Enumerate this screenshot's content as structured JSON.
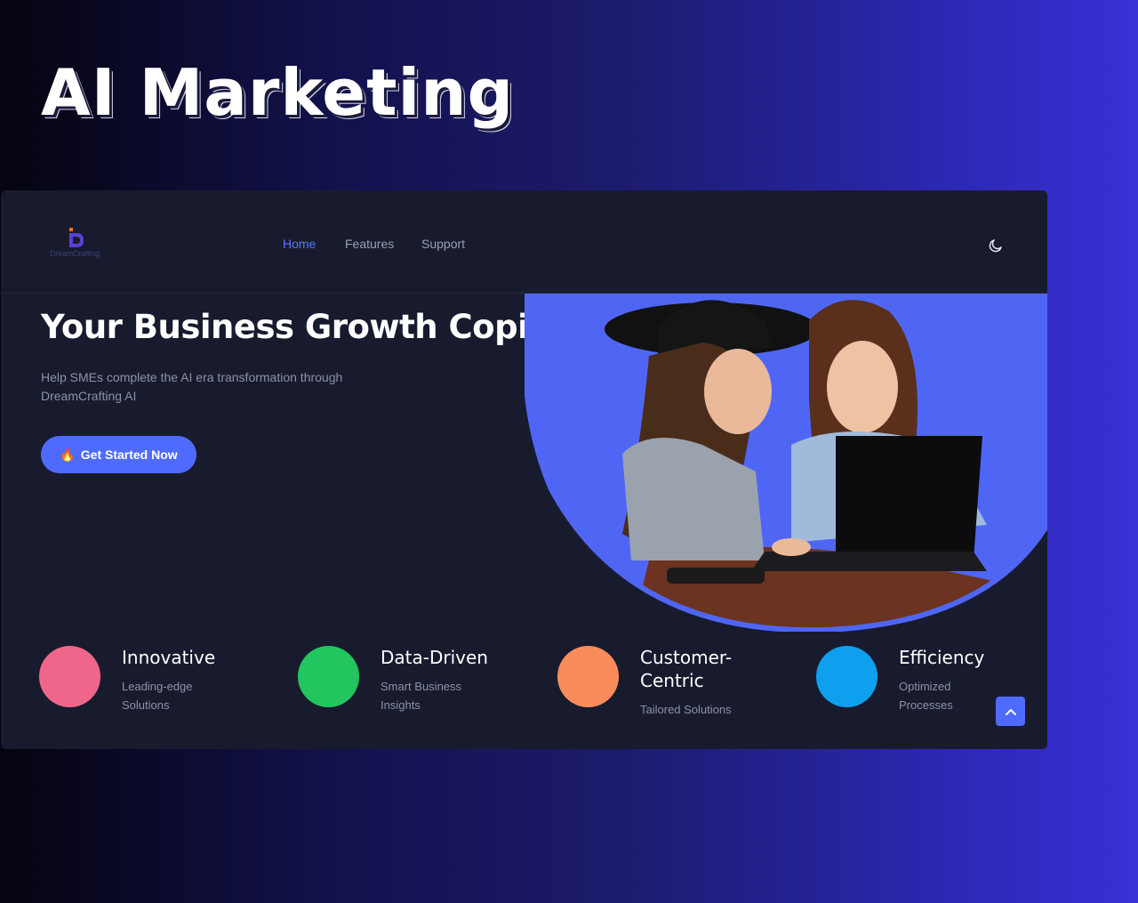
{
  "promo": {
    "title": "AI Marketing"
  },
  "app": {
    "logo_text": "DreamCrafting",
    "nav": [
      {
        "label": "Home",
        "active": true
      },
      {
        "label": "Features",
        "active": false
      },
      {
        "label": "Support",
        "active": false
      }
    ],
    "theme_toggle_icon": "moon-icon"
  },
  "hero": {
    "title": "Your Business Growth Copilot",
    "subtitle": "Help SMEs complete the AI era transformation through DreamCrafting AI",
    "cta_icon": "🔥",
    "cta_label": "Get Started Now",
    "image_subject": "two women looking at a laptop"
  },
  "features": [
    {
      "title": "Innovative",
      "desc": "Leading-edge Solutions",
      "color": "#f0668a"
    },
    {
      "title": "Data-Driven",
      "desc": "Smart Business Insights",
      "color": "#22c55e"
    },
    {
      "title": "Customer-Centric",
      "desc": "Tailored Solutions",
      "color": "#fa8c5c"
    },
    {
      "title": "Efficiency",
      "desc": "Optimized Processes",
      "color": "#0ea0ef"
    }
  ],
  "colors": {
    "accent": "#4f6bff",
    "card_bg": "#181b2e"
  }
}
